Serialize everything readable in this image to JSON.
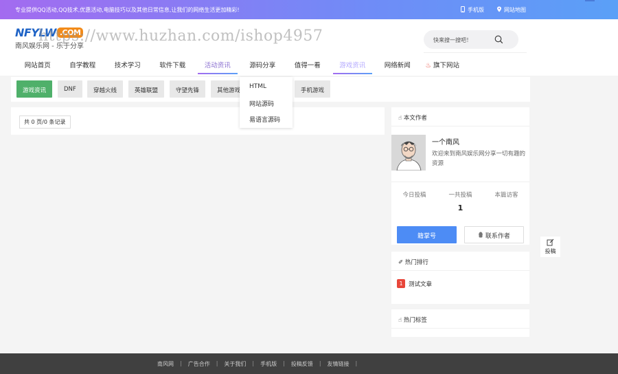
{
  "topbar": {
    "notice": "专业提供QQ活动,QQ技术,优惠活动,电脑技巧以及其他日常信息,让我们的网络生活更加精彩!",
    "mobile_label": "手机版",
    "sitemap_label": "网站地图"
  },
  "logo": {
    "brand": "NFYLW",
    "com": ".COM",
    "subtitle": "南风娱乐网 - 乐于分享"
  },
  "watermark": "https://www.huzhan.com/ishop4957",
  "search": {
    "placeholder": "快来搜一搜吧！"
  },
  "nav": {
    "items": [
      {
        "label": "网站首页"
      },
      {
        "label": "自学教程"
      },
      {
        "label": "技术学习"
      },
      {
        "label": "软件下载"
      },
      {
        "label": "活动资讯"
      },
      {
        "label": "源码分享"
      },
      {
        "label": "值得一看"
      },
      {
        "label": "游戏资讯"
      },
      {
        "label": "网络新闻"
      },
      {
        "label": "旗下网站"
      }
    ]
  },
  "categories": [
    {
      "label": "游戏资讯"
    },
    {
      "label": "DNF"
    },
    {
      "label": "穿越火线"
    },
    {
      "label": "英雄联盟"
    },
    {
      "label": "守望先锋"
    },
    {
      "label": "其他游戏"
    },
    {
      "label": "手机游戏"
    }
  ],
  "dropdown": {
    "items": [
      {
        "label": "HTML"
      },
      {
        "label": "网站源码"
      },
      {
        "label": "易语言源码"
      }
    ]
  },
  "main": {
    "pager_text": "共 0 页/0 条记录"
  },
  "sidebar": {
    "author_title": "本文作者",
    "author_name": "一个南风",
    "author_desc": "欢迎来到南风娱乐网分享一切有趣的资源",
    "stats": [
      {
        "label": "今日投稿",
        "value": ""
      },
      {
        "label": "一共投稿",
        "value": "1"
      },
      {
        "label": "本篇访客",
        "value": ""
      }
    ],
    "follow_label": "籍掌号",
    "contact_label": "联系作者",
    "hot_title": "热门排行",
    "hot_items": [
      {
        "rank": "1",
        "title": "测试文章"
      }
    ],
    "tags_title": "热门标签"
  },
  "float_post_label": "投稿",
  "footer": {
    "links": [
      {
        "label": "南风网"
      },
      {
        "label": "广告合作"
      },
      {
        "label": "关于我们"
      },
      {
        "label": "手机版"
      },
      {
        "label": "投稿反馈"
      },
      {
        "label": "友情链接"
      }
    ]
  },
  "colors": {
    "topbar_start": "#a36bf0",
    "topbar_end": "#5aa0f7",
    "category_active": "#4fb06a",
    "follow_button": "#4d8cf5",
    "rank_badge": "#e8463a",
    "footer_bg": "#404040"
  }
}
